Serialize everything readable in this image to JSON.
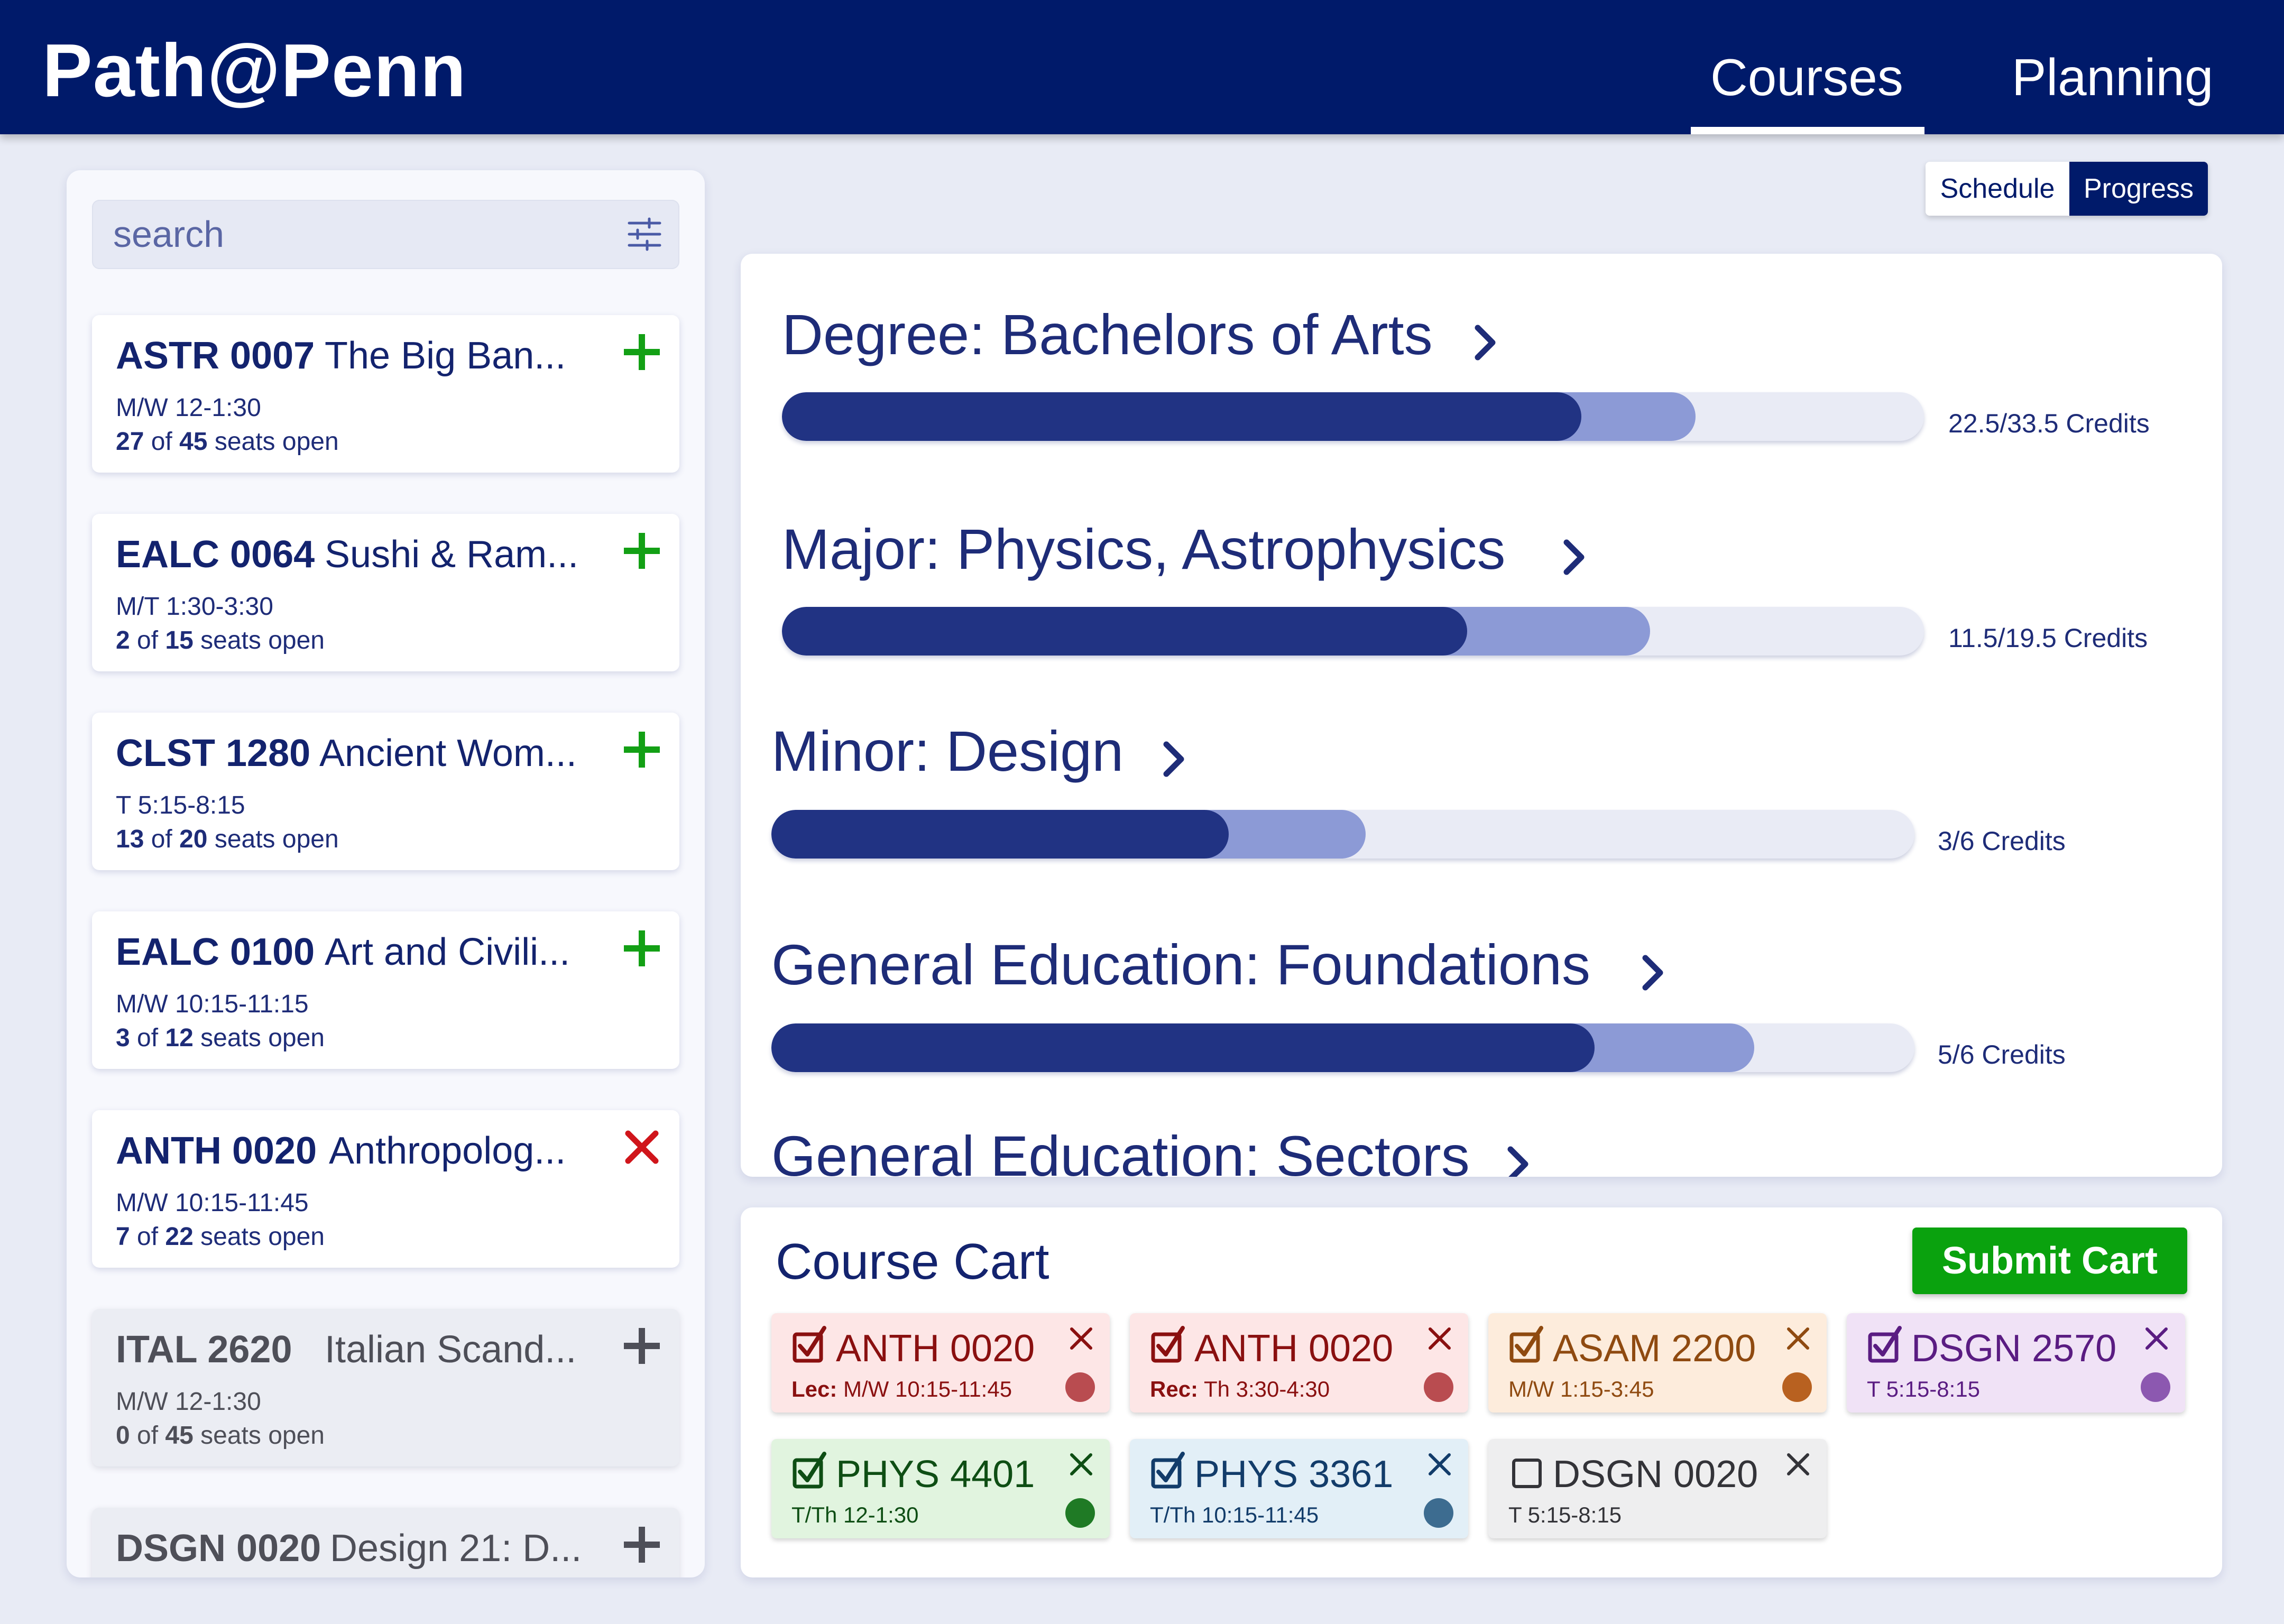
{
  "header": {
    "logo": "Path@Penn",
    "tabs": [
      "Courses",
      "Planning"
    ],
    "active_tab": "Courses"
  },
  "search": {
    "placeholder": "search",
    "value": ""
  },
  "courses": [
    {
      "code": "ASTR 0007",
      "title": "The Big Ban...",
      "time": "M/W 12-1:30",
      "seats_open": "27",
      "seats_total": "45",
      "seats_suffix": "seats open",
      "action": "add",
      "status": "open"
    },
    {
      "code": "EALC 0064",
      "title": "Sushi & Ram...",
      "time": "M/T 1:30-3:30",
      "seats_open": "2",
      "seats_total": "15",
      "seats_suffix": "seats open",
      "action": "add",
      "status": "open"
    },
    {
      "code": "CLST 1280",
      "title": "Ancient Wom...",
      "time": "T 5:15-8:15",
      "seats_open": "13",
      "seats_total": "20",
      "seats_suffix": "seats open",
      "action": "add",
      "status": "open"
    },
    {
      "code": "EALC 0100",
      "title": "Art and Civili...",
      "time": "M/W 10:15-11:15",
      "seats_open": "3",
      "seats_total": "12",
      "seats_suffix": "seats open",
      "action": "add",
      "status": "open"
    },
    {
      "code": "ANTH 0020",
      "title": "Anthropolog...",
      "time": "M/W 10:15-11:45",
      "seats_open": "7",
      "seats_total": "22",
      "seats_suffix": "seats open",
      "action": "remove",
      "status": "in-cart"
    },
    {
      "code": "ITAL 2620",
      "title": "Italian Scand...",
      "time": "M/W 12-1:30",
      "seats_open": "0",
      "seats_total": "45",
      "seats_suffix": "seats open",
      "action": "add",
      "status": "full"
    },
    {
      "code": "DSGN 0020",
      "title": "Design 21: D...",
      "time": "",
      "seats_open": "",
      "seats_total": "",
      "seats_suffix": "",
      "action": "add",
      "status": "full"
    }
  ],
  "view_toggle": {
    "options": [
      "Schedule",
      "Progress"
    ],
    "selected": "Progress"
  },
  "requirements": [
    {
      "title": "Degree: Bachelors of Arts",
      "credits_text": "22.5/33.5 Credits",
      "completed": 0.7,
      "planned": 0.8
    },
    {
      "title": "Major: Physics, Astrophysics",
      "credits_text": "11.5/19.5 Credits",
      "completed": 0.6,
      "planned": 0.76
    },
    {
      "title": "Minor: Design",
      "credits_text": "3/6 Credits",
      "completed": 0.4,
      "planned": 0.52
    },
    {
      "title": "General Education: Foundations",
      "credits_text": "5/6 Credits",
      "completed": 0.72,
      "planned": 0.86
    },
    {
      "title": "General Education: Sectors",
      "credits_text": "",
      "completed": 0,
      "planned": 0
    }
  ],
  "cart": {
    "title": "Course Cart",
    "submit_label": "Submit Cart",
    "items": [
      {
        "code": "ANTH 0020",
        "label_bold": "Lec:",
        "detail": "M/W 10:15-11:45",
        "checked": true,
        "bg": "#fde6e6",
        "fg": "#8a1010",
        "dot": "#b94c50"
      },
      {
        "code": "ANTH 0020",
        "label_bold": "Rec:",
        "detail": "Th 3:30-4:30",
        "checked": true,
        "bg": "#fde6e6",
        "fg": "#8a1010",
        "dot": "#b94c50"
      },
      {
        "code": "ASAM 2200",
        "label_bold": "",
        "detail": "M/W 1:15-3:45",
        "checked": true,
        "bg": "#fdecdc",
        "fg": "#8f4a10",
        "dot": "#b86120"
      },
      {
        "code": "DSGN 2570",
        "label_bold": "",
        "detail": "T 5:15-8:15",
        "checked": true,
        "bg": "#f0e2f6",
        "fg": "#5a1c82",
        "dot": "#8c58b0"
      },
      {
        "code": "PHYS 4401",
        "label_bold": "",
        "detail": "T/Th 12-1:30",
        "checked": true,
        "bg": "#e1f4df",
        "fg": "#0e4e14",
        "dot": "#1f7a25"
      },
      {
        "code": "PHYS 3361",
        "label_bold": "",
        "detail": "T/Th 10:15-11:45",
        "checked": true,
        "bg": "#e2eff7",
        "fg": "#123c6a",
        "dot": "#3d6c90"
      },
      {
        "code": "DSGN 0020",
        "label_bold": "",
        "detail": "T 5:15-8:15",
        "checked": false,
        "bg": "#eeeeef",
        "fg": "#333338",
        "dot": ""
      }
    ]
  },
  "colors": {
    "brand_navy": "#001a6a",
    "text_navy": "#1e2c78",
    "add_green": "#13a015",
    "remove_red": "#d0151b",
    "submit_green": "#0aa20e",
    "bar_completed": "#213383",
    "bar_planned": "#8c9ad6",
    "bar_track": "#e9ebf5"
  }
}
